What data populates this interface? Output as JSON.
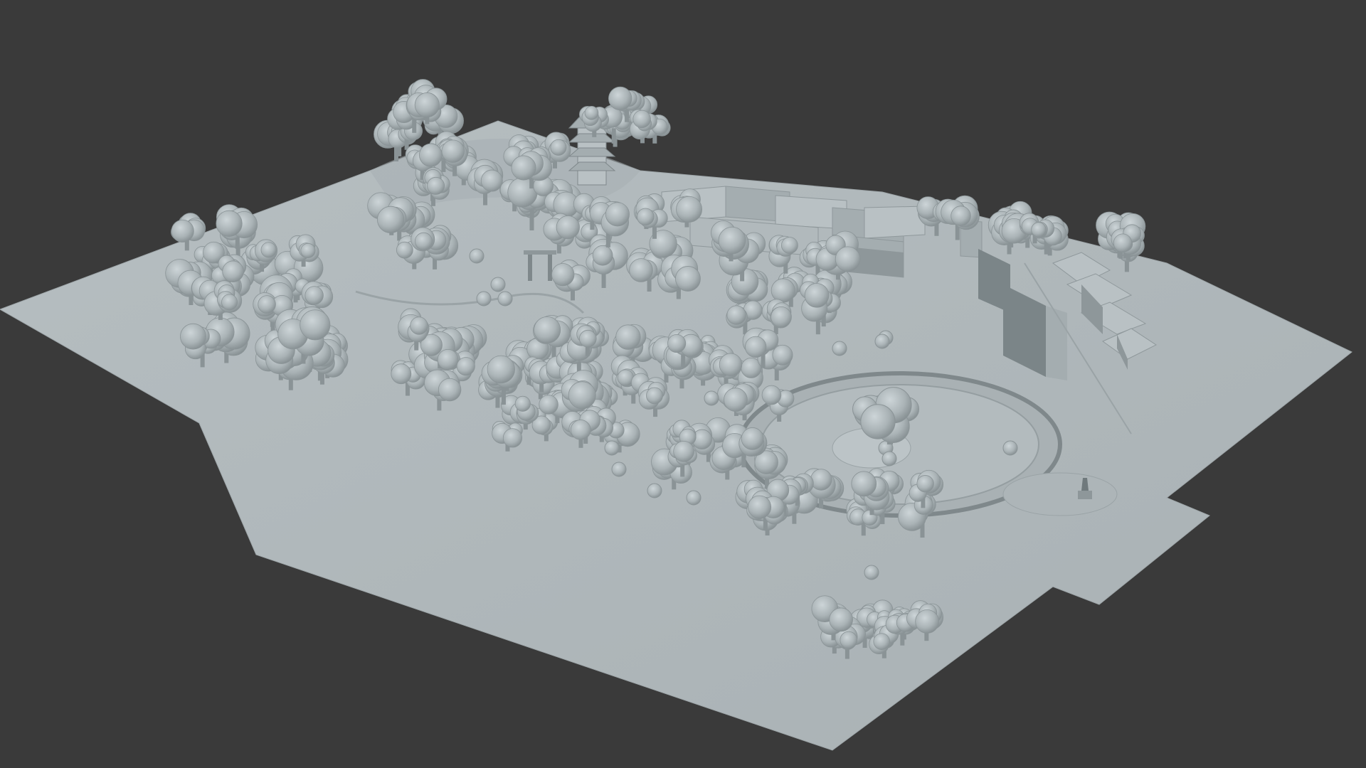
{
  "viewport": {
    "label": "",
    "background": "#3a3a3a"
  },
  "scene": {
    "ground_color": "#b2babd",
    "ground_shadow": "#8f989b",
    "tree_light": "#c4cccf",
    "tree_mid": "#a9b2b5",
    "tree_dark": "#7f888b",
    "building_light": "#b9c1c4",
    "building_dark": "#7b8588",
    "objects": [
      "terrain-plane",
      "pagoda",
      "torii-gate",
      "circular-plaza",
      "central-tree",
      "row-buildings",
      "terraced-buildings",
      "tree-clusters",
      "statue"
    ]
  }
}
